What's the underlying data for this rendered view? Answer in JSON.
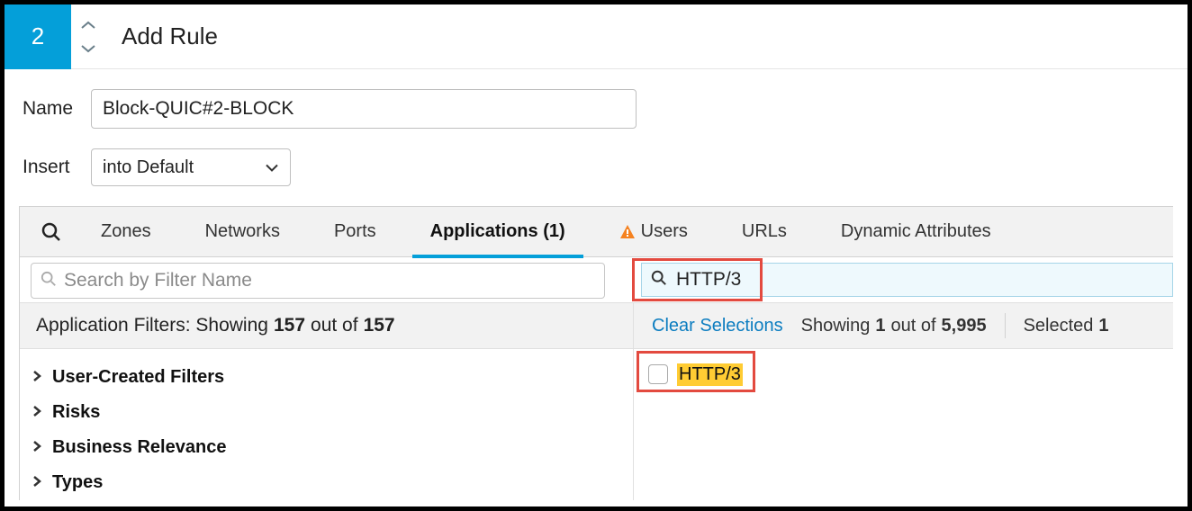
{
  "header": {
    "rule_number": "2",
    "title": "Add Rule"
  },
  "form": {
    "name_label": "Name",
    "name_value": "Block-QUIC#2-BLOCK",
    "insert_label": "Insert",
    "insert_value": "into Default"
  },
  "tabs": {
    "zones": "Zones",
    "networks": "Networks",
    "ports": "Ports",
    "applications": "Applications (1)",
    "users": "Users",
    "urls": "URLs",
    "dynamic_attributes": "Dynamic Attributes"
  },
  "filter_search": {
    "placeholder": "Search by Filter Name"
  },
  "app_search": {
    "value": "HTTP/3"
  },
  "status": {
    "left_prefix": "Application Filters: Showing",
    "left_shown": "157",
    "left_mid": "out of",
    "left_total": "157",
    "clear": "Clear Selections",
    "show_prefix": "Showing",
    "show_shown": "1",
    "show_mid": "out of",
    "show_total": "5,995",
    "selected_label": "Selected",
    "selected_count": "1"
  },
  "filter_categories": {
    "user_created": "User-Created Filters",
    "risks": "Risks",
    "business": "Business Relevance",
    "types": "Types"
  },
  "results": {
    "item1": "HTTP/3"
  }
}
